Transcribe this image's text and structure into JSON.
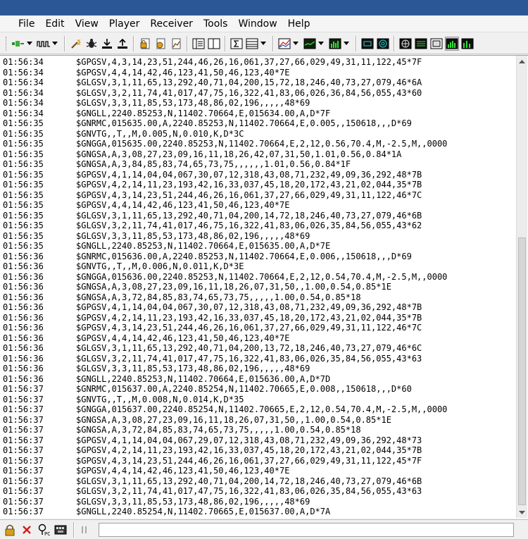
{
  "menu": {
    "items": [
      "File",
      "Edit",
      "View",
      "Player",
      "Receiver",
      "Tools",
      "Window",
      "Help"
    ]
  },
  "toolbar": {
    "icons": [
      "connect-icon",
      "nmea-wave-icon",
      "search-icon",
      "debug-bug-icon",
      "download-icon",
      "upload-icon",
      "lock-icon",
      "settings-icon",
      "chart-icon",
      "split-view-icon",
      "sum-icon",
      "table-icon",
      "graph-icon",
      "signal-line-icon",
      "bar-chart-icon",
      "satellite-view-icon",
      "compass-icon",
      "message-view-icon",
      "packet-icon",
      "grid-icon",
      "level-icon",
      "statistics-icon"
    ]
  },
  "log": {
    "lines": [
      {
        "t": "01:56:34",
        "m": "$GPGSV,4,3,14,23,51,244,46,26,16,061,37,27,66,029,49,31,11,122,45*7F"
      },
      {
        "t": "01:56:34",
        "m": "$GPGSV,4,4,14,42,46,123,41,50,46,123,40*7E"
      },
      {
        "t": "01:56:34",
        "m": "$GLGSV,3,1,11,65,13,292,40,71,04,200,15,72,18,246,40,73,27,079,46*6A"
      },
      {
        "t": "01:56:34",
        "m": "$GLGSV,3,2,11,74,41,017,47,75,16,322,41,83,06,026,36,84,56,055,43*60"
      },
      {
        "t": "01:56:34",
        "m": "$GLGSV,3,3,11,85,53,173,48,86,02,196,,,,,48*69"
      },
      {
        "t": "01:56:34",
        "m": "$GNGLL,2240.85253,N,11402.70664,E,015634.00,A,D*7F"
      },
      {
        "t": "01:56:35",
        "m": "$GNRMC,015635.00,A,2240.85253,N,11402.70664,E,0.005,,150618,,,D*69"
      },
      {
        "t": "01:56:35",
        "m": "$GNVTG,,T,,M,0.005,N,0.010,K,D*3C"
      },
      {
        "t": "01:56:35",
        "m": "$GNGGA,015635.00,2240.85253,N,11402.70664,E,2,12,0.56,70.4,M,-2.5,M,,0000"
      },
      {
        "t": "01:56:35",
        "m": "$GNGSA,A,3,08,27,23,09,16,11,18,26,42,07,31,50,1.01,0.56,0.84*1A"
      },
      {
        "t": "01:56:35",
        "m": "$GNGSA,A,3,84,85,83,74,65,73,75,,,,,,1.01,0.56,0.84*1F"
      },
      {
        "t": "01:56:35",
        "m": "$GPGSV,4,1,14,04,04,067,30,07,12,318,43,08,71,232,49,09,36,292,48*7B"
      },
      {
        "t": "01:56:35",
        "m": "$GPGSV,4,2,14,11,23,193,42,16,33,037,45,18,20,172,43,21,02,044,35*7B"
      },
      {
        "t": "01:56:35",
        "m": "$GPGSV,4,3,14,23,51,244,46,26,16,061,37,27,66,029,49,31,11,122,46*7C"
      },
      {
        "t": "01:56:35",
        "m": "$GPGSV,4,4,14,42,46,123,41,50,46,123,40*7E"
      },
      {
        "t": "01:56:35",
        "m": "$GLGSV,3,1,11,65,13,292,40,71,04,200,14,72,18,246,40,73,27,079,46*6B"
      },
      {
        "t": "01:56:35",
        "m": "$GLGSV,3,2,11,74,41,017,46,75,16,322,41,83,06,026,35,84,56,055,43*62"
      },
      {
        "t": "01:56:35",
        "m": "$GLGSV,3,3,11,85,53,173,48,86,02,196,,,,,48*69"
      },
      {
        "t": "01:56:35",
        "m": "$GNGLL,2240.85253,N,11402.70664,E,015635.00,A,D*7E"
      },
      {
        "t": "01:56:36",
        "m": "$GNRMC,015636.00,A,2240.85253,N,11402.70664,E,0.006,,150618,,,D*69"
      },
      {
        "t": "01:56:36",
        "m": "$GNVTG,,T,,M,0.006,N,0.011,K,D*3E"
      },
      {
        "t": "01:56:36",
        "m": "$GNGGA,015636.00,2240.85253,N,11402.70664,E,2,12,0.54,70.4,M,-2.5,M,,0000"
      },
      {
        "t": "01:56:36",
        "m": "$GNGSA,A,3,08,27,23,09,16,11,18,26,07,31,50,,1.00,0.54,0.85*1E"
      },
      {
        "t": "01:56:36",
        "m": "$GNGSA,A,3,72,84,85,83,74,65,73,75,,,,,1.00,0.54,0.85*18"
      },
      {
        "t": "01:56:36",
        "m": "$GPGSV,4,1,14,04,04,067,30,07,12,318,43,08,71,232,49,09,36,292,48*7B"
      },
      {
        "t": "01:56:36",
        "m": "$GPGSV,4,2,14,11,23,193,42,16,33,037,45,18,20,172,43,21,02,044,35*7B"
      },
      {
        "t": "01:56:36",
        "m": "$GPGSV,4,3,14,23,51,244,46,26,16,061,37,27,66,029,49,31,11,122,46*7C"
      },
      {
        "t": "01:56:36",
        "m": "$GPGSV,4,4,14,42,46,123,41,50,46,123,40*7E"
      },
      {
        "t": "01:56:36",
        "m": "$GLGSV,3,1,11,65,13,292,40,71,04,200,13,72,18,246,40,73,27,079,46*6C"
      },
      {
        "t": "01:56:36",
        "m": "$GLGSV,3,2,11,74,41,017,47,75,16,322,41,83,06,026,35,84,56,055,43*63"
      },
      {
        "t": "01:56:36",
        "m": "$GLGSV,3,3,11,85,53,173,48,86,02,196,,,,,48*69"
      },
      {
        "t": "01:56:36",
        "m": "$GNGLL,2240.85253,N,11402.70664,E,015636.00,A,D*7D"
      },
      {
        "t": "01:56:37",
        "m": "$GNRMC,015637.00,A,2240.85254,N,11402.70665,E,0.008,,150618,,,D*60"
      },
      {
        "t": "01:56:37",
        "m": "$GNVTG,,T,,M,0.008,N,0.014,K,D*35"
      },
      {
        "t": "01:56:37",
        "m": "$GNGGA,015637.00,2240.85254,N,11402.70665,E,2,12,0.54,70.4,M,-2.5,M,,0000"
      },
      {
        "t": "01:56:37",
        "m": "$GNGSA,A,3,08,27,23,09,16,11,18,26,07,31,50,,1.00,0.54,0.85*1E"
      },
      {
        "t": "01:56:37",
        "m": "$GNGSA,A,3,72,84,85,83,74,65,73,75,,,,,1.00,0.54,0.85*18"
      },
      {
        "t": "01:56:37",
        "m": "$GPGSV,4,1,14,04,04,067,29,07,12,318,43,08,71,232,49,09,36,292,48*73"
      },
      {
        "t": "01:56:37",
        "m": "$GPGSV,4,2,14,11,23,193,42,16,33,037,45,18,20,172,43,21,02,044,35*7B"
      },
      {
        "t": "01:56:37",
        "m": "$GPGSV,4,3,14,23,51,244,46,26,16,061,37,27,66,029,49,31,11,122,45*7F"
      },
      {
        "t": "01:56:37",
        "m": "$GPGSV,4,4,14,42,46,123,41,50,46,123,40*7E"
      },
      {
        "t": "01:56:37",
        "m": "$GLGSV,3,1,11,65,13,292,40,71,04,200,14,72,18,246,40,73,27,079,46*6B"
      },
      {
        "t": "01:56:37",
        "m": "$GLGSV,3,2,11,74,41,017,47,75,16,322,41,83,06,026,35,84,56,055,43*63"
      },
      {
        "t": "01:56:37",
        "m": "$GLGSV,3,3,11,85,53,173,48,86,02,196,,,,,48*69"
      },
      {
        "t": "01:56:37",
        "m": "$GNGLL,2240.85254,N,11402.70665,E,015637.00,A,D*7A"
      }
    ]
  },
  "statusbar": {
    "icons": [
      "lock-icon",
      "close-icon",
      "pc-connection-icon",
      "port-icon",
      "pause-icon"
    ],
    "field_value": ""
  },
  "colors": {
    "title_bar": "#2b5797",
    "background": "#f0f0f0",
    "log_background": "#ffffff",
    "status_lock": "#d4a017",
    "status_close": "#cc1f1f"
  }
}
